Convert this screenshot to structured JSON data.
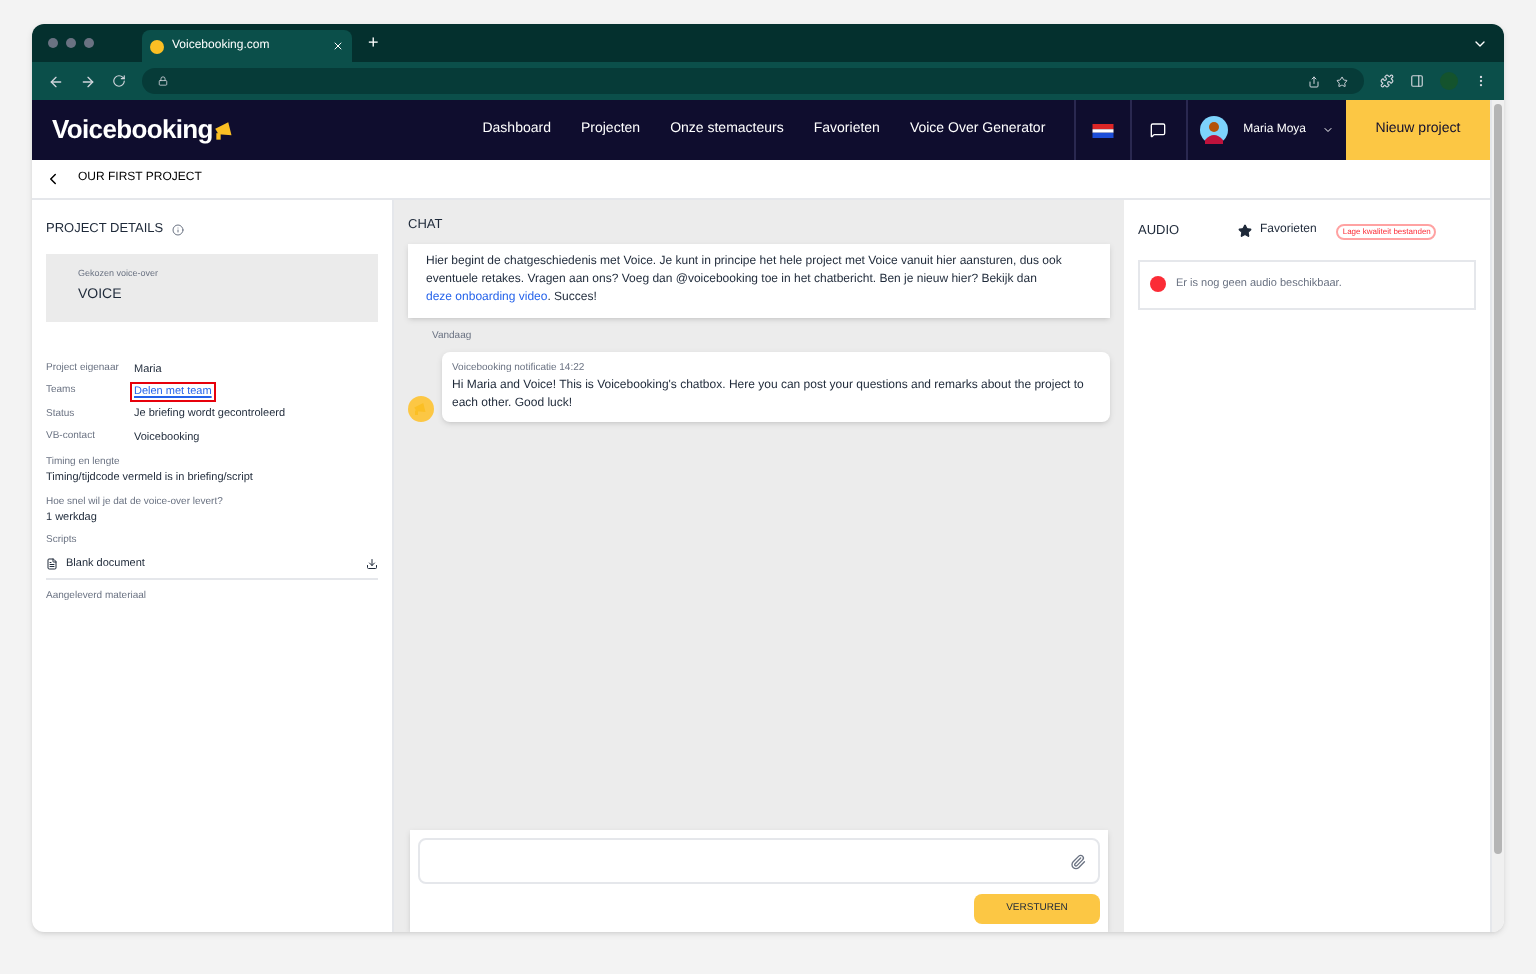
{
  "browser": {
    "tab_title": "Voicebooking.com",
    "new_tab": "+"
  },
  "navbar": {
    "logo": "Voicebooking",
    "links": [
      {
        "label": "Dashboard"
      },
      {
        "label": "Projecten"
      },
      {
        "label": "Onze stemacteurs"
      },
      {
        "label": "Favorieten"
      },
      {
        "label": "Voice Over Generator"
      }
    ],
    "user": "Maria Moya",
    "cta": "Nieuw project"
  },
  "breadcrumb": {
    "title": "OUR FIRST PROJECT"
  },
  "details": {
    "heading": "PROJECT DETAILS",
    "chosen_label": "Gekozen voice-over",
    "chosen_value": "VOICE",
    "fields": [
      {
        "label": "Project eigenaar",
        "value": "Maria",
        "kind": "text",
        "highlighted": false
      },
      {
        "label": "Teams",
        "value": "Delen met team",
        "kind": "link",
        "highlighted": true
      },
      {
        "label": "Status",
        "value": "Je briefing wordt gecontroleerd",
        "kind": "text",
        "highlighted": false
      },
      {
        "label": "VB-contact",
        "value": "Voicebooking",
        "kind": "text",
        "highlighted": false
      }
    ],
    "blocks": [
      {
        "label": "Timing en lengte",
        "value": "Timing/tijdcode vermeld is in briefing/script"
      },
      {
        "label": "Hoe snel wil je dat de voice-over levert?",
        "value": "1 werkdag"
      }
    ],
    "scripts_label": "Scripts",
    "script_file": "Blank document",
    "material_label": "Aangeleverd materiaal"
  },
  "chat": {
    "heading": "CHAT",
    "intro": "Hier begint de chatgeschiedenis met Voice. Je kunt in principe het hele project met Voice vanuit hier aansturen, dus ook eventuele retakes. Vragen aan ons? Voeg dan @voicebooking toe in het chatbericht. Ben je nieuw hier? Bekijk dan",
    "intro_link": "deze onboarding video",
    "intro_end": ". Succes!",
    "day": "Vandaag",
    "messages": [
      {
        "sender": "Voicebooking notificatie",
        "time": "14:22",
        "text": "Hi Maria and Voice! This is Voicebooking's chatbox. Here you can post your questions and remarks about the project to each other. Good luck!"
      }
    ],
    "send": "VERSTUREN"
  },
  "audio": {
    "heading": "AUDIO",
    "favorites": "Favorieten",
    "low_quality": "Lage kwaliteit bestanden",
    "empty": "Er is nog geen audio beschikbaar."
  }
}
